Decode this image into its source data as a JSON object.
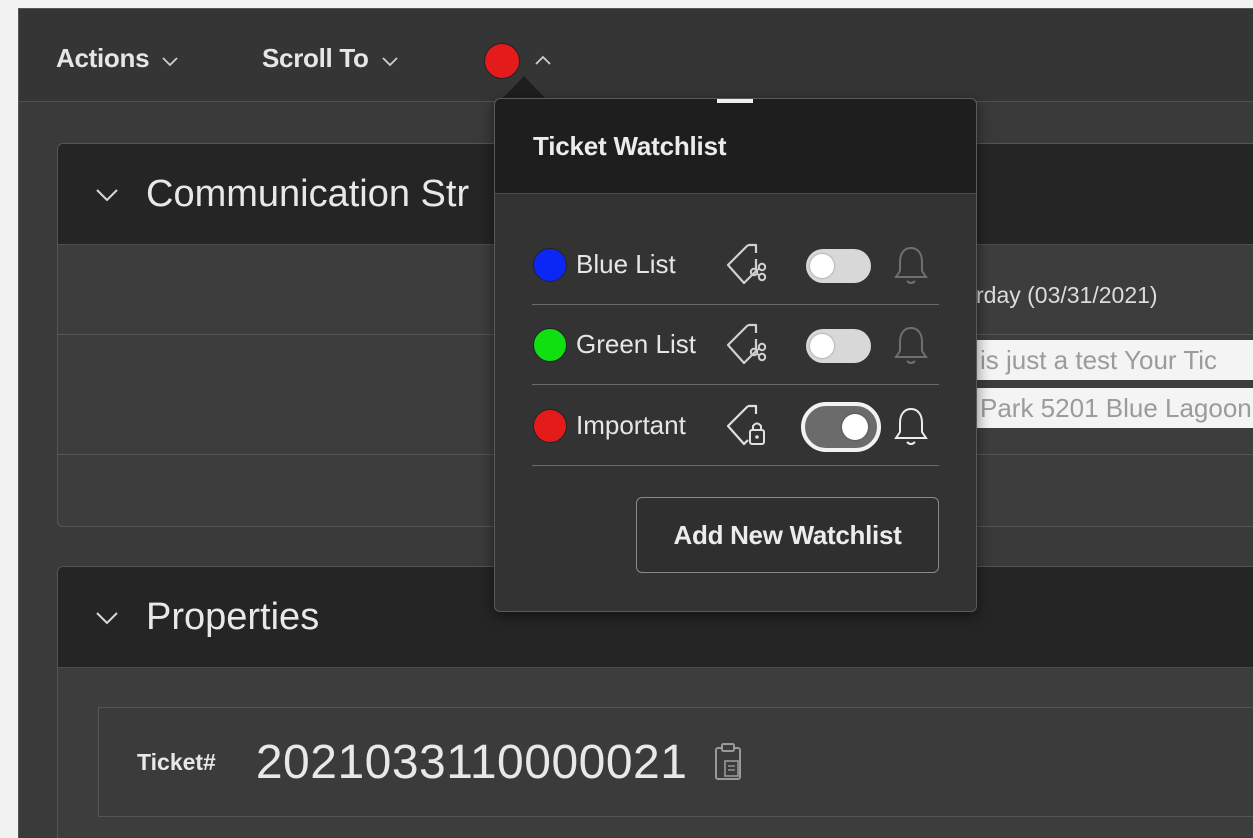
{
  "toolbar": {
    "actions_label": "Actions",
    "scroll_to_label": "Scroll To",
    "watchlist_indicator_color": "#e41b1b"
  },
  "communication": {
    "title": "Communication Str",
    "date_text": "rday (03/31/2021)",
    "message_line_1": "is just a test Your Tic",
    "message_line_2": "Park 5201 Blue Lagoon"
  },
  "properties": {
    "title": "Properties",
    "ticket_label": "Ticket#",
    "ticket_value": "2021033110000021"
  },
  "watchlist_popover": {
    "title": "Ticket Watchlist",
    "items": [
      {
        "name": "Blue List",
        "color": "#0b27f5",
        "icon": "tag-share-icon",
        "enabled": false,
        "notify": false
      },
      {
        "name": "Green List",
        "color": "#10e010",
        "icon": "tag-share-icon",
        "enabled": false,
        "notify": false
      },
      {
        "name": "Important",
        "color": "#e41b1b",
        "icon": "tag-lock-icon",
        "enabled": true,
        "notify": true
      }
    ],
    "add_button_label": "Add New Watchlist"
  }
}
